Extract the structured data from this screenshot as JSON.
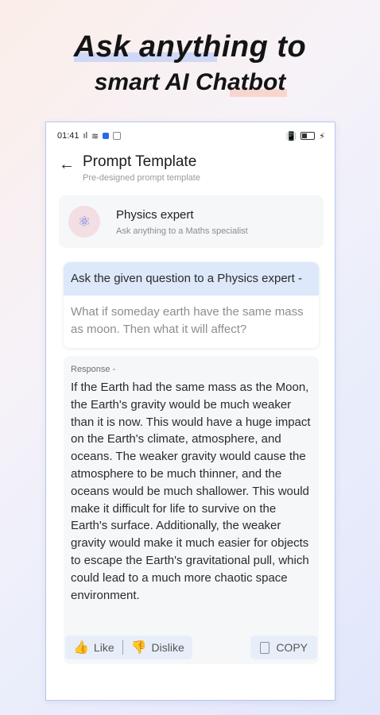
{
  "promo": {
    "line1": "Ask anything to",
    "line2": "smart AI Chatbot"
  },
  "statusbar": {
    "time": "01:41",
    "signal": "ıl",
    "wifi": "≋",
    "battery_label": ""
  },
  "header": {
    "title": "Prompt Template",
    "subtitle": "Pre-designed prompt template"
  },
  "expert": {
    "name": "Physics expert",
    "description": "Ask anything to a Maths specialist"
  },
  "prompt": {
    "instruction": "Ask the given question to a Physics expert -",
    "question": "What if someday earth have the same mass as moon. Then what it will affect?"
  },
  "response": {
    "label": "Response -",
    "text": "If the Earth had the same mass as the Moon, the Earth's gravity would be much weaker than it is now. This would have a huge impact on the Earth's climate, atmosphere, and oceans. The weaker gravity would cause the atmosphere to be much thinner, and the oceans would be much shallower. This would make it difficult for life to survive on the Earth's surface. Additionally, the weaker gravity would make it much easier for objects to escape the Earth's gravitational pull, which could lead to a much more chaotic space environment."
  },
  "actions": {
    "like_label": "Like",
    "dislike_label": "Dislike",
    "copy_label": "COPY"
  },
  "colors": {
    "accent": "#dde8fb",
    "thumb": "#f2a81d"
  }
}
